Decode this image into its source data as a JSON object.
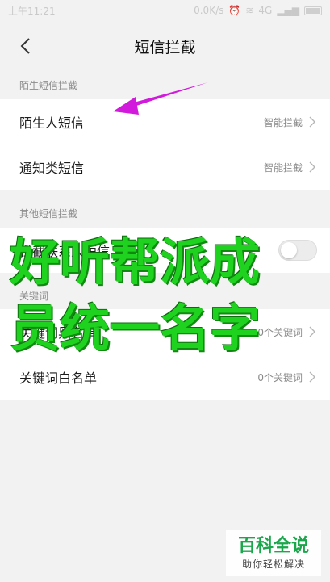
{
  "status_bar": {
    "time": "上午11:21",
    "network": "0.0K/s",
    "signal": "4G"
  },
  "header": {
    "title": "短信拦截"
  },
  "stranger_section": {
    "label": "陌生短信拦截",
    "items": [
      {
        "label": "陌生人短信",
        "value": "智能拦截"
      },
      {
        "label": "通知类短信",
        "value": "智能拦截"
      }
    ]
  },
  "other_section": {
    "label": "其他短信拦截",
    "items": [
      {
        "label": "拦截联系人短信",
        "toggle": false
      }
    ]
  },
  "keyword_section": {
    "label": "关键词",
    "items": [
      {
        "label": "关键词黑名单",
        "value": "0个关键词"
      },
      {
        "label": "关键词白名单",
        "value": "0个关键词"
      }
    ]
  },
  "overlay_text": {
    "line1": "好听帮派成",
    "line2": "员统一名字"
  },
  "watermark": {
    "title": "百科全说",
    "subtitle": "助你轻松解决"
  },
  "colors": {
    "overlay": "#1fd21f",
    "arrow": "#d21adc",
    "watermark": "#1aa64b"
  }
}
